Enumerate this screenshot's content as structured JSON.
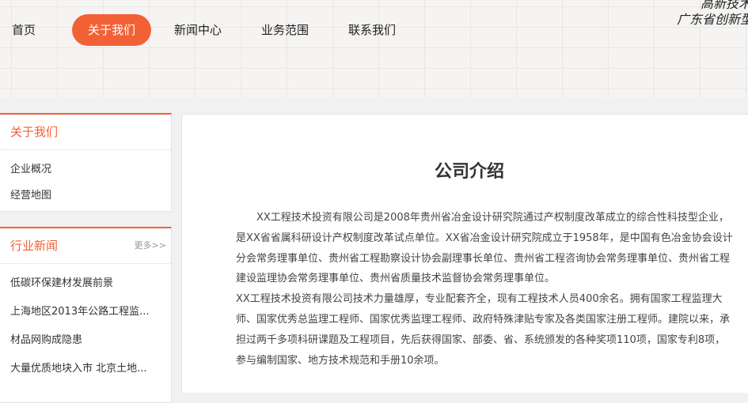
{
  "header": {
    "tagline_line1": "高新技术",
    "tagline_line2": "广东省创新型"
  },
  "nav": {
    "items": [
      {
        "label": "首页"
      },
      {
        "label": "关于我们",
        "active": true
      },
      {
        "label": "新闻中心"
      },
      {
        "label": "业务范围"
      },
      {
        "label": "联系我们"
      }
    ]
  },
  "sidebar": {
    "about": {
      "title": "关于我们",
      "links": [
        "企业概况",
        "经营地图"
      ]
    },
    "news": {
      "title": "行业新闻",
      "more": "更多>>",
      "items": [
        "低碳环保建材发展前景",
        "上海地区2013年公路工程监...",
        "材品网购成隐患",
        "大量优质地块入市 北京土地..."
      ]
    }
  },
  "main": {
    "title": "公司介绍",
    "paragraphs": [
      "XX工程技术投资有限公司是2008年贵州省冶金设计研究院通过产权制度改革成立的综合性科技型企业，是XX省省属科研设计产权制度改革试点单位。XX省冶金设计研究院成立于1958年，是中国有色冶金协会设计分会常务理事单位、贵州省工程勘察设计协会副理事长单位、贵州省工程咨询协会常务理事单位、贵州省工程建设监理协会常务理事单位、贵州省质量技术监督协会常务理事单位。",
      "XX工程技术投资有限公司技术力量雄厚，专业配套齐全，现有工程技术人员400余名。拥有国家工程监理大师、国家优秀总监理工程师、国家优秀监理工程师、政府特殊津贴专家及各类国家注册工程师。建院以来，承担过两千多项科研课题及工程项目，先后获得国家、部委、省、系统颁发的各种奖项110项，国家专利8项，参与编制国家、地方技术规范和手册10余项。"
    ]
  }
}
